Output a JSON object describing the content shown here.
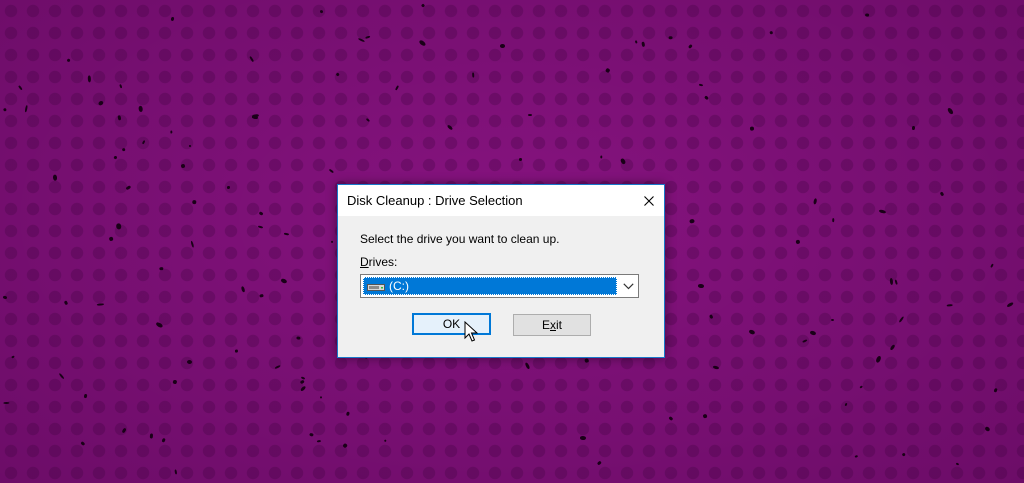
{
  "dialog": {
    "title": "Disk Cleanup : Drive Selection",
    "prompt": "Select the drive you want to clean up.",
    "drives_label_accel": "D",
    "drives_label_rest": "rives:",
    "selected_drive": "(C:)",
    "ok_label": "OK",
    "exit_label_before": "E",
    "exit_label_accel": "x",
    "exit_label_after": "it"
  },
  "colors": {
    "desktop": "#86137f",
    "accent": "#0078d7",
    "dialog_border": "#1979ca"
  },
  "icons": {
    "close": "close-icon",
    "drive": "hard-drive-icon",
    "dropdown": "chevron-down-icon",
    "cursor": "mouse-pointer-icon"
  }
}
